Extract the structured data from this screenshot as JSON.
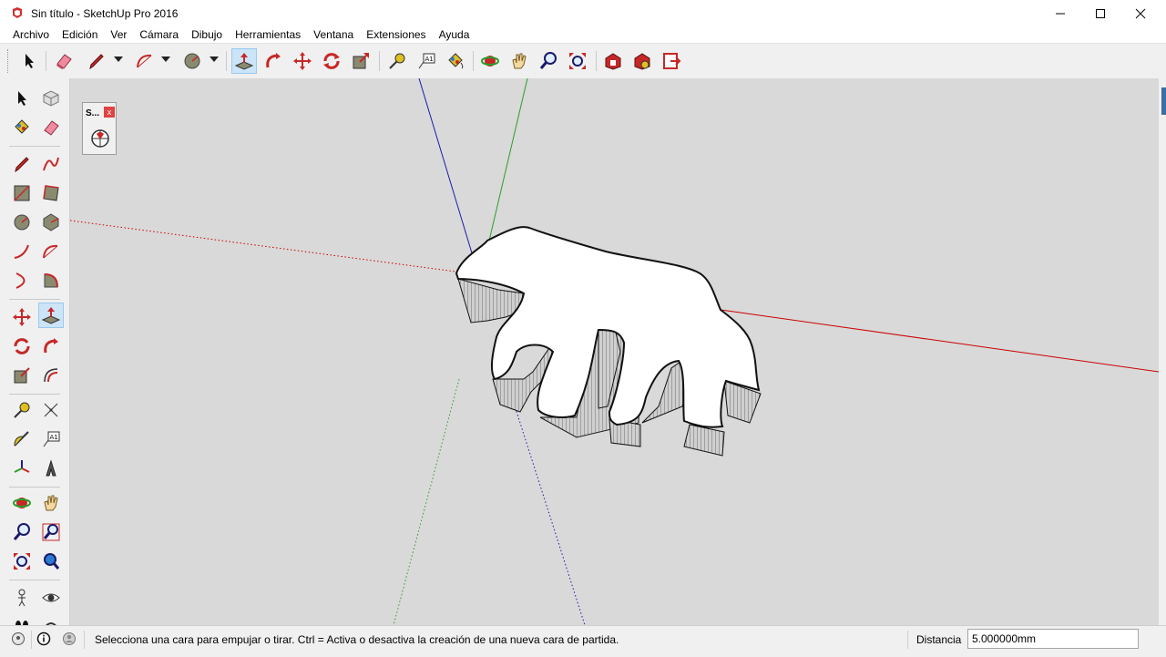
{
  "window": {
    "title": "Sin título - SketchUp Pro 2016",
    "minimize_icon": "minimize-icon",
    "maximize_icon": "maximize-icon",
    "close_icon": "close-icon"
  },
  "menu": {
    "items": [
      {
        "label": "Archivo"
      },
      {
        "label": "Edición"
      },
      {
        "label": "Ver"
      },
      {
        "label": "Cámara"
      },
      {
        "label": "Dibujo"
      },
      {
        "label": "Herramientas"
      },
      {
        "label": "Ventana"
      },
      {
        "label": "Extensiones"
      },
      {
        "label": "Ayuda"
      }
    ]
  },
  "toolbar": {
    "tools": [
      "select-icon",
      "eraser-icon",
      "pencil-icon",
      "arc-icon",
      "circle-icon",
      "push-pull-icon",
      "follow-me-icon",
      "move-icon",
      "rotate-icon",
      "scale-icon",
      "tape-measure-icon",
      "text-icon",
      "paint-bucket-icon",
      "orbit-icon",
      "pan-icon",
      "zoom-icon",
      "zoom-extents-icon",
      "warehouse-icon",
      "extension-warehouse-icon",
      "send-to-layout-icon"
    ]
  },
  "mini_window": {
    "title": "S...",
    "close": "x"
  },
  "status": {
    "message": "Selecciona una cara para empujar o tirar. Ctrl = Activa o desactiva la creación de una nueva cara de partida.",
    "measure_label": "Distancia",
    "measure_value": "5.000000mm"
  },
  "colors": {
    "viewport_bg": "#d9d9d9",
    "axis_red": "#cc0000",
    "axis_green": "#2a9d2a",
    "axis_blue": "#1a1aaa",
    "active_tool": "#cce4f7"
  }
}
